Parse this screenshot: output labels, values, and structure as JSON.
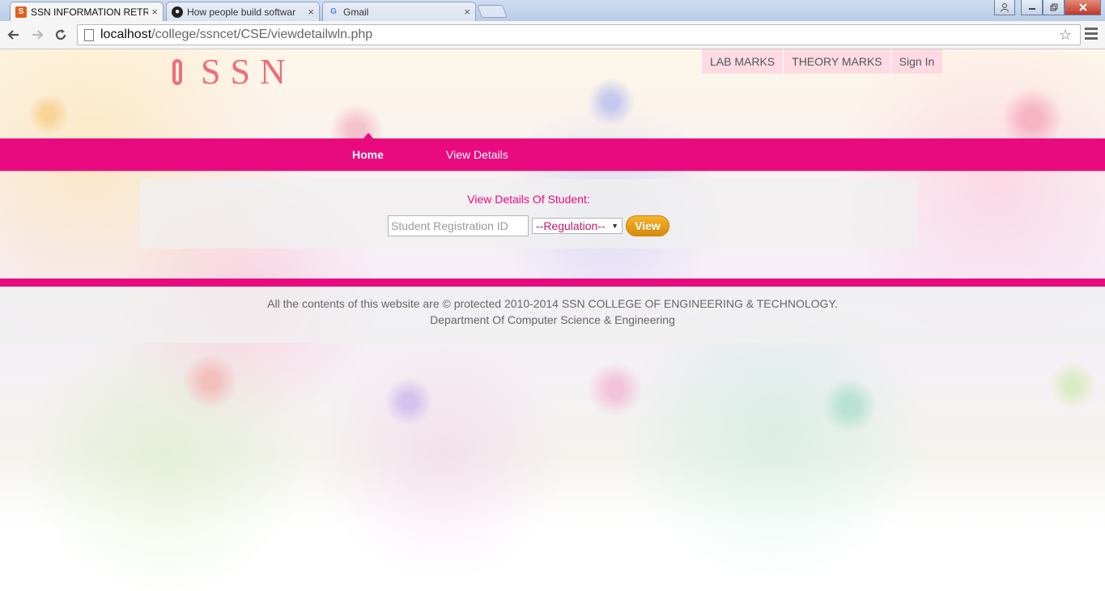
{
  "browser": {
    "tabs": [
      {
        "title": "SSN INFORMATION RETRI",
        "active": true,
        "favicon": "ssn-favicon"
      },
      {
        "title": "How people build softwar",
        "active": false,
        "favicon": "github-icon"
      },
      {
        "title": "Gmail",
        "active": false,
        "favicon": "google-icon"
      }
    ],
    "tab_close_glyph": "×",
    "url_host": "localhost",
    "url_path": "/college/ssncet/CSE/viewdetailwln.php"
  },
  "header": {
    "logo_text": "SSN",
    "top_links": [
      "LAB MARKS",
      "THEORY MARKS",
      "Sign In"
    ]
  },
  "nav": {
    "home": "Home",
    "view_details": "View Details"
  },
  "form": {
    "title": "View Details Of Student:",
    "reg_placeholder": "Student Registration ID",
    "regulation_selected": "--Regulation--",
    "view_label": "View"
  },
  "footer": {
    "line1": "All the contents of this website are © protected 2010-2014 SSN COLLEGE OF ENGINEERING & TECHNOLOGY.",
    "line2": "Department Of Computer Science & Engineering"
  },
  "colors": {
    "accent": "#ea0a80",
    "logo": "#f06c78",
    "button": "#f0a41e"
  }
}
